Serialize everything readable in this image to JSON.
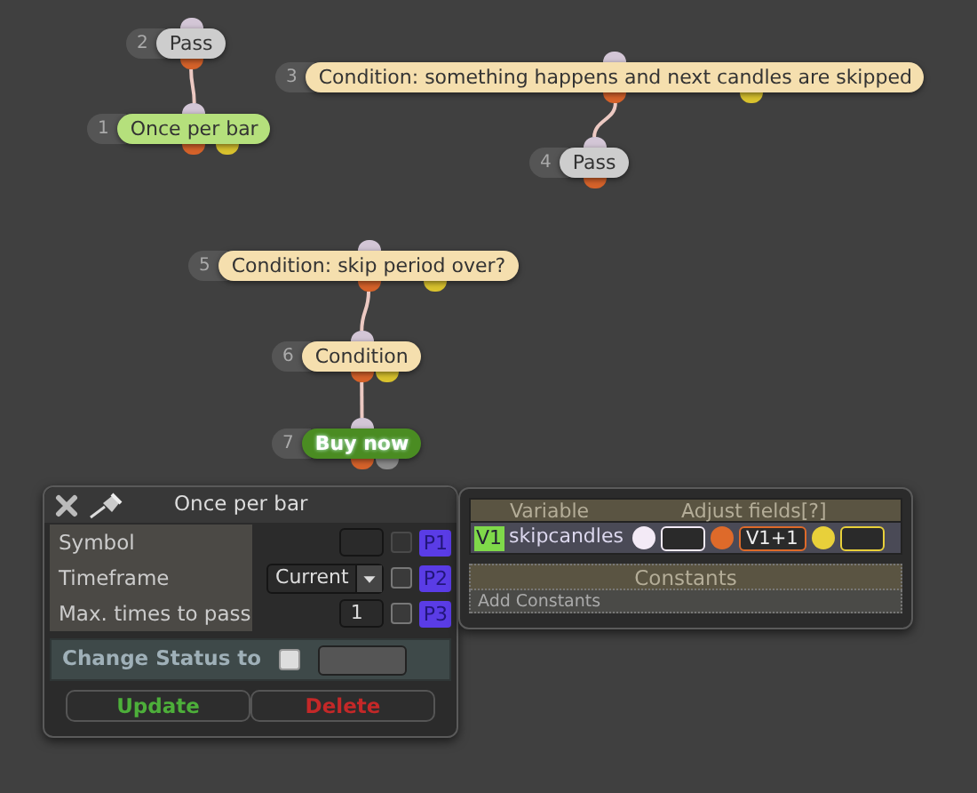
{
  "nodes": [
    {
      "number": "2",
      "label": "Pass",
      "bold": false,
      "color": "#cdcdcd",
      "outputs": [
        {
          "color": "#d5622a"
        }
      ],
      "children": [
        {
          "number": "1",
          "label": "Once per bar",
          "bold": false,
          "color": "#b5e07c",
          "outputs": [
            {
              "color": "#d5622a"
            },
            {
              "color": "#d9c22e"
            }
          ]
        }
      ]
    },
    {
      "number": "3",
      "label": "Condition: something happens and next candles are skipped",
      "bold": false,
      "color": "#f5dfae",
      "outputs": [
        {
          "color": "#d5622a"
        },
        {
          "color": "#d9c22e"
        }
      ],
      "children": [
        {
          "number": "4",
          "label": "Pass",
          "bold": false,
          "color": "#cdcdcd",
          "outputs": [
            {
              "color": "#d5622a"
            }
          ]
        }
      ]
    },
    {
      "number": "5",
      "label": "Condition: skip period over?",
      "bold": false,
      "color": "#f5dfae",
      "outputs": [
        {
          "color": "#d5622a"
        },
        {
          "color": "#d9c22e"
        }
      ],
      "children": [
        {
          "number": "6",
          "label": "Condition",
          "bold": false,
          "color": "#f5dfae",
          "outputs": [
            {
              "color": "#d5622a"
            },
            {
              "color": "#d9c22e"
            }
          ],
          "children": [
            {
              "number": "7",
              "label": "Buy now",
              "bold": true,
              "color": "#4a8c22",
              "outputs": [
                {
                  "color": "#d5622a"
                },
                {
                  "color": "#8c8c8c"
                }
              ]
            }
          ]
        }
      ]
    }
  ],
  "panel": {
    "title": "Once per bar",
    "params": [
      {
        "label": "Symbol",
        "kind": "text",
        "param": "P1",
        "checked": false,
        "disabled": true
      },
      {
        "label": "Timeframe",
        "kind": "select",
        "value": "Current",
        "param": "P2",
        "checked": false,
        "disabled": false
      },
      {
        "label": "Max. times to pass",
        "kind": "text",
        "value": "1",
        "param": "P3",
        "checked": false,
        "disabled": false
      }
    ],
    "status": {
      "label": "Change Status to",
      "checked": false
    },
    "buttons": [
      {
        "label": "Update",
        "kind": "update"
      },
      {
        "label": "Delete",
        "kind": "delete"
      }
    ]
  },
  "variables": {
    "columns": [
      "Variable",
      "Adjust fields[?]"
    ],
    "rows": [
      {
        "id": "V1",
        "name": "skipcandles",
        "fields": [
          {
            "color": "#f3eaf6"
          },
          {
            "color": "#de6a2a",
            "value": "V1+1"
          },
          {
            "color": "#e8d03a"
          }
        ]
      }
    ],
    "constants": {
      "title": "Constants",
      "add": "Add Constants"
    }
  }
}
